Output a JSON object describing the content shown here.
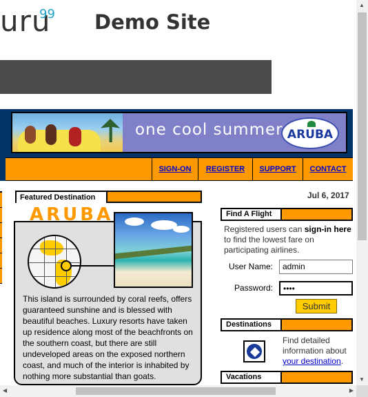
{
  "header": {
    "logo_text": "uru",
    "logo_sup": "99",
    "site_title": "Demo Site"
  },
  "banner": {
    "tagline": "one cool summer",
    "logo_text": "ARUBA"
  },
  "nav": {
    "items": [
      {
        "label": "SIGN-ON"
      },
      {
        "label": "REGISTER"
      },
      {
        "label": "SUPPORT"
      },
      {
        "label": "CONTACT"
      }
    ]
  },
  "featured": {
    "heading": "Featured Destination",
    "title": "ARUBA",
    "description": "This island is surrounded by coral reefs, offers guaranteed sunshine and is blessed with beautiful beaches. Luxury resorts have taken up residence along most of the beachfronts on the southern coast, but there are still undeveloped areas on the exposed northern coast, and much of the interior is inhabited by nothing more substantial than goats."
  },
  "date": "Jul 6, 2017",
  "find_flight": {
    "heading": "Find A Flight",
    "intro_pre": "Registered users can ",
    "intro_bold": "sign-in here",
    "intro_post": " to find the lowest fare on participating airlines.",
    "username_label": "User Name:",
    "username_value": "admin",
    "password_label": "Password:",
    "password_value": "••••",
    "submit_label": "Submit"
  },
  "destinations": {
    "heading": "Destinations",
    "text_pre": "Find detailed information about ",
    "link_text": "your destination",
    "text_post": "."
  },
  "vacations": {
    "heading": "Vacations"
  },
  "colors": {
    "accent_orange": "#ff9900",
    "frame_blue": "#003366",
    "link_blue": "#0000cc",
    "submit_yellow": "#ffcc00"
  }
}
